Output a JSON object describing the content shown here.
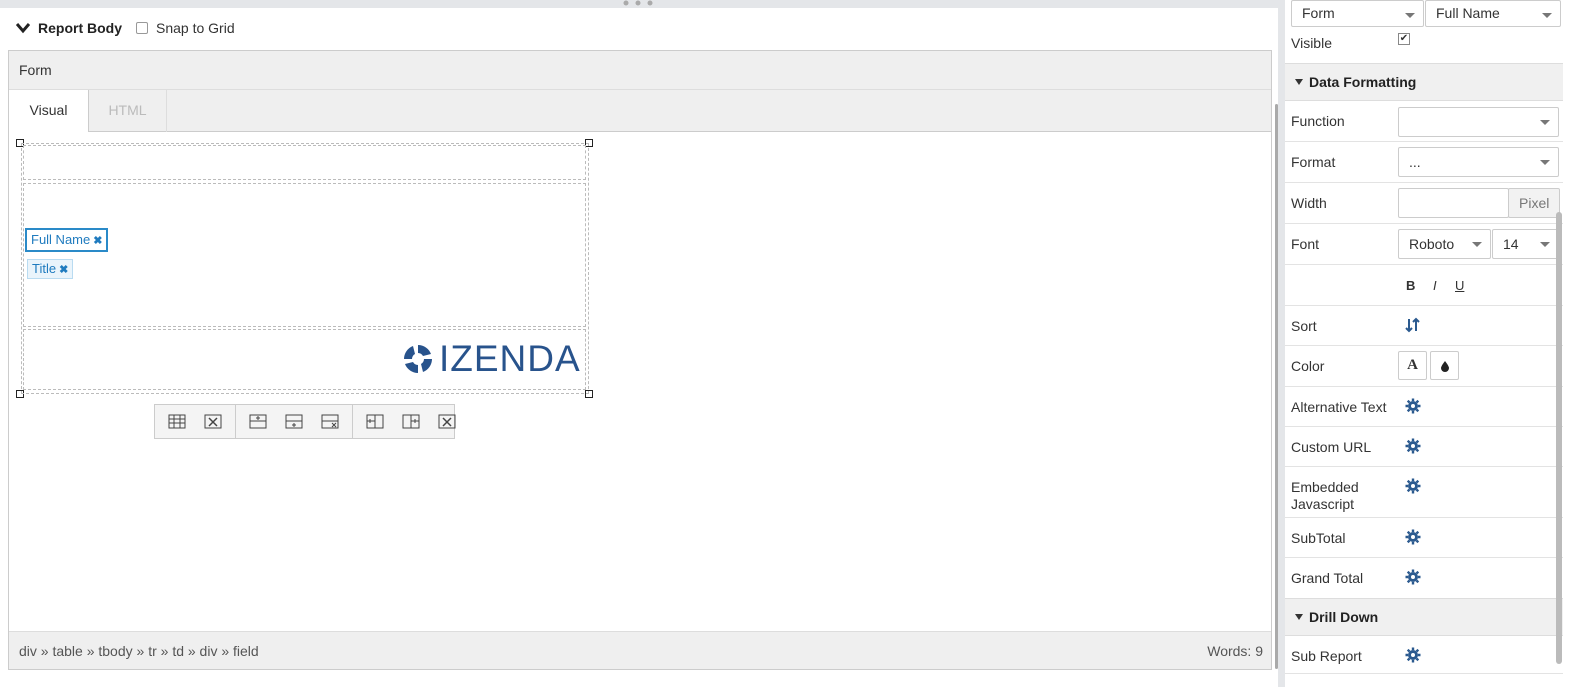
{
  "report_body": {
    "title": "Report Body",
    "snap_to_grid": "Snap to Grid",
    "form_label": "Form",
    "tabs": [
      {
        "label": "Visual"
      },
      {
        "label": "HTML"
      }
    ],
    "fields": [
      {
        "label": "Full Name"
      },
      {
        "label": "Title"
      }
    ],
    "logo_text": "IZENDA",
    "status_path": "div » table » tbody » tr » td » div » field",
    "status_words": "Words: 9"
  },
  "properties": {
    "top_selects": {
      "element": "Form",
      "field": "Full Name"
    },
    "visible_label": "Visible",
    "visible_checked": true,
    "sections": {
      "data_formatting": "Data Formatting",
      "drill_down": "Drill Down"
    },
    "function_label": "Function",
    "function_value": "",
    "format_label": "Format",
    "format_value": "...",
    "width_label": "Width",
    "width_unit": "Pixel",
    "font_label": "Font",
    "font_family": "Roboto",
    "font_size": "14",
    "style_buttons": {
      "bold": "B",
      "italic": "I",
      "underline": "U"
    },
    "sort_label": "Sort",
    "color_label": "Color",
    "color_text_glyph": "A",
    "alt_text_label": "Alternative Text",
    "custom_url_label": "Custom URL",
    "embedded_js_label_1": "Embedded",
    "embedded_js_label_2": "Javascript",
    "subtotal_label": "SubTotal",
    "grand_total_label": "Grand Total",
    "sub_report_label": "Sub Report"
  },
  "colors": {
    "accent": "#1f7bbf",
    "gear": "#2b5a8f",
    "logo": "#28538c"
  }
}
